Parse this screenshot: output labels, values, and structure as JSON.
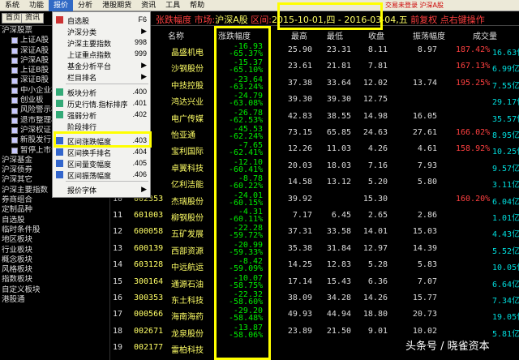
{
  "menubar": {
    "items": [
      "系统",
      "功能",
      "报价",
      "分析",
      "港股期货",
      "资讯",
      "工具",
      "帮助"
    ],
    "right_text": "交易未登录    沪深A股"
  },
  "toolbar": {
    "btn1": "首页",
    "btn2": "资讯",
    "title_prefix": "张跌幅度 市场:",
    "market": "沪深A股",
    "interval_label": "区间:",
    "date_range": "2015-10-01,四 - 2016-03-04,五",
    "suffix": "前复权 点右键操作"
  },
  "sidebar": {
    "items": [
      {
        "label": "沪深股票",
        "type": "top"
      },
      {
        "label": "上证A股",
        "type": "child"
      },
      {
        "label": "深证A股",
        "type": "child"
      },
      {
        "label": "沪深A股",
        "type": "child"
      },
      {
        "label": "上证B股",
        "type": "child"
      },
      {
        "label": "深证B股",
        "type": "child"
      },
      {
        "label": "中小企业板",
        "type": "child"
      },
      {
        "label": "创业板",
        "type": "child"
      },
      {
        "label": "风险警示板",
        "type": "child"
      },
      {
        "label": "退市整理板",
        "type": "child"
      },
      {
        "label": "沪深权证",
        "type": "child"
      },
      {
        "label": "新股发行",
        "type": "child"
      },
      {
        "label": "暂停上市公司",
        "type": "child"
      },
      {
        "label": "沪深基金",
        "type": "top"
      },
      {
        "label": "沪深债券",
        "type": "top"
      },
      {
        "label": "沪深其它",
        "type": "top"
      },
      {
        "label": "沪深主要指数",
        "type": "top"
      },
      {
        "label": "券商组合",
        "type": "top"
      },
      {
        "label": "定制品种",
        "type": "top"
      },
      {
        "label": "自选股",
        "type": "top"
      },
      {
        "label": "临时条件股",
        "type": "top"
      },
      {
        "label": "地区板块",
        "type": "top"
      },
      {
        "label": "行业板块",
        "type": "top"
      },
      {
        "label": "概念板块",
        "type": "top"
      },
      {
        "label": "风格板块",
        "type": "top"
      },
      {
        "label": "指数板块",
        "type": "top"
      },
      {
        "label": "自定义板块",
        "type": "top"
      },
      {
        "label": "港股通",
        "type": "top"
      }
    ]
  },
  "menu": {
    "items": [
      {
        "label": "自选股",
        "shortcut": "F6"
      },
      {
        "label": "沪深分类",
        "shortcut": "▶"
      },
      {
        "label": "沪深主要指数",
        "shortcut": "998"
      },
      {
        "label": "上证重点指数",
        "shortcut": "999"
      },
      {
        "label": "基金分析平台",
        "shortcut": "▶"
      },
      {
        "label": "栏目排名",
        "shortcut": "▶"
      },
      {
        "label": "板块分析",
        "shortcut": ".400"
      },
      {
        "label": "历史行情.指标排序",
        "shortcut": ".401"
      },
      {
        "label": "强弱分析",
        "shortcut": ".402"
      },
      {
        "label": "阶段排行",
        "shortcut": ""
      },
      {
        "label": "区间涨跌幅度",
        "shortcut": ".403"
      },
      {
        "label": "区间换手排名",
        "shortcut": ".404"
      },
      {
        "label": "区间量变幅度",
        "shortcut": ".405"
      },
      {
        "label": "区间振荡幅度",
        "shortcut": ".406"
      },
      {
        "label": "报价字体",
        "shortcut": "▶"
      }
    ]
  },
  "table": {
    "headers": [
      "名称",
      "涨跌幅度",
      "最高",
      "最低",
      "收盘",
      "振荡幅度",
      "成交量"
    ],
    "rows": [
      {
        "idx": "1",
        "code": "",
        "name": "晶盛机电",
        "chg1": "-16.93",
        "chg2": "-65.37%",
        "hi": "25.90",
        "lo": "23.31",
        "a": "8.11",
        "b": "8.97",
        "c": "187.42%",
        "d": "16.63亿"
      },
      {
        "idx": "2",
        "code": "",
        "name": "沙钢股份",
        "chg1": "-15.37",
        "chg2": "-65.10%",
        "hi": "23.61",
        "lo": "21.81",
        "a": "7.81",
        "b": "",
        "c": "167.13%",
        "d": "6.99亿"
      },
      {
        "idx": "3",
        "code": "",
        "name": "中技控股",
        "chg1": "-23.64",
        "chg2": "-63.24%",
        "hi": "37.38",
        "lo": "33.64",
        "a": "12.02",
        "b": "13.74",
        "c": "195.25%",
        "d": "7.55亿"
      },
      {
        "idx": "4",
        "code": "",
        "name": "鸿达兴业",
        "chg1": "-24.79",
        "chg2": "-63.08%",
        "hi": "39.30",
        "lo": "39.30",
        "a": "12.75",
        "b": "",
        "c": "",
        "d": "29.17亿"
      },
      {
        "idx": "5",
        "code": "",
        "name": "电广传媒",
        "chg1": "-26.78",
        "chg2": "-62.53%",
        "hi": "42.83",
        "lo": "38.55",
        "a": "14.98",
        "b": "16.05",
        "c": "",
        "d": "35.57亿"
      },
      {
        "idx": "6",
        "code": "",
        "name": "怡亚通",
        "chg1": "-45.53",
        "chg2": "-62.24%",
        "hi": "73.15",
        "lo": "65.85",
        "a": "24.63",
        "b": "27.61",
        "c": "166.02%",
        "d": "8.95亿"
      },
      {
        "idx": "7",
        "code": "",
        "name": "宝利国际",
        "chg1": "-7.65",
        "chg2": "-62.41%",
        "hi": "12.26",
        "lo": "11.03",
        "a": "4.26",
        "b": "4.61",
        "c": "158.92%",
        "d": "10.25亿"
      },
      {
        "idx": "8",
        "code": "",
        "name": "卓翼科技",
        "chg1": "-12.10",
        "chg2": "-60.41%",
        "hi": "20.03",
        "lo": "18.03",
        "a": "7.16",
        "b": "7.93",
        "c": "",
        "d": "9.57亿"
      },
      {
        "idx": "9",
        "code": "",
        "name": "亿利洁能",
        "chg1": "-8.78",
        "chg2": "-60.22%",
        "hi": "14.58",
        "lo": "13.12",
        "a": "5.20",
        "b": "5.80",
        "c": "",
        "d": "3.11亿"
      },
      {
        "idx": "10",
        "code": "002353",
        "name": "杰瑞股份",
        "chg1": "-24.01",
        "chg2": "-60.15%",
        "hi": "39.92",
        "lo": "",
        "a": "15.30",
        "b": "",
        "c": "160.20%",
        "d": "6.04亿"
      },
      {
        "idx": "11",
        "code": "601003",
        "name": "柳钢股份",
        "chg1": "-4.31",
        "chg2": "-60.11%",
        "hi": "7.17",
        "lo": "6.45",
        "a": "2.65",
        "b": "2.86",
        "c": "",
        "d": "1.01亿"
      },
      {
        "idx": "12",
        "code": "600058",
        "name": "五矿发展",
        "chg1": "-22.28",
        "chg2": "-59.72%",
        "hi": "37.31",
        "lo": "33.58",
        "a": "14.01",
        "b": "15.03",
        "c": "",
        "d": "4.43亿"
      },
      {
        "idx": "13",
        "code": "600139",
        "name": "西部资源",
        "chg1": "-20.99",
        "chg2": "-59.33%",
        "hi": "35.38",
        "lo": "31.84",
        "a": "12.97",
        "b": "14.39",
        "c": "",
        "d": "5.52亿"
      },
      {
        "idx": "14",
        "code": "603128",
        "name": "中远航运",
        "chg1": "-8.42",
        "chg2": "-59.09%",
        "hi": "14.25",
        "lo": "12.83",
        "a": "5.28",
        "b": "5.83",
        "c": "",
        "d": "10.05亿"
      },
      {
        "idx": "15",
        "code": "300164",
        "name": "通源石油",
        "chg1": "-10.07",
        "chg2": "-58.75%",
        "hi": "17.14",
        "lo": "15.43",
        "a": "6.36",
        "b": "7.07",
        "c": "",
        "d": "6.64亿"
      },
      {
        "idx": "16",
        "code": "300353",
        "name": "东土科技",
        "chg1": "-22.32",
        "chg2": "-58.60%",
        "hi": "38.09",
        "lo": "34.28",
        "a": "14.26",
        "b": "15.77",
        "c": "",
        "d": "7.34亿"
      },
      {
        "idx": "17",
        "code": "000566",
        "name": "海南海药",
        "chg1": "-29.20",
        "chg2": "-58.48%",
        "hi": "49.93",
        "lo": "44.94",
        "a": "18.80",
        "b": "20.73",
        "c": "",
        "d": "19.05亿"
      },
      {
        "idx": "18",
        "code": "002671",
        "name": "龙泉股份",
        "chg1": "-13.87",
        "chg2": "-58.06%",
        "hi": "23.89",
        "lo": "21.50",
        "a": "9.01",
        "b": "10.02",
        "c": "",
        "d": "5.81亿"
      },
      {
        "idx": "19",
        "code": "002177",
        "name": "雷柏科技",
        "chg1": "",
        "chg2": "",
        "hi": "",
        "lo": "",
        "a": "",
        "b": "",
        "c": "",
        "d": ""
      }
    ]
  },
  "watermark": "头条号 / 晓雀资本"
}
